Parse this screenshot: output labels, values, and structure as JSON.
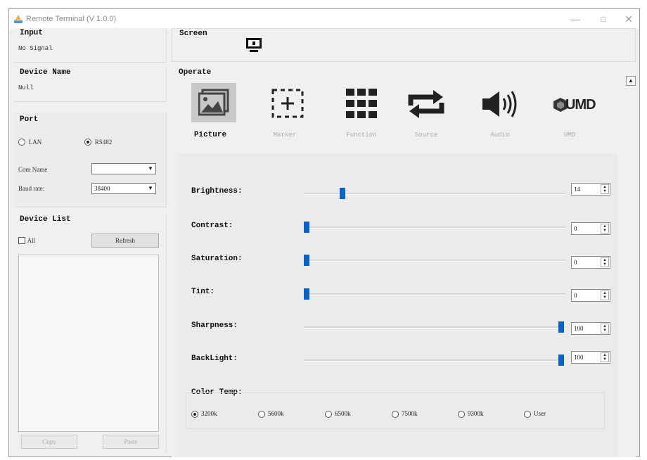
{
  "window": {
    "title": "Remote Terminal (V 1.0.0)",
    "controls": {
      "minimize": "—",
      "maximize": "□",
      "close": "✕"
    }
  },
  "input": {
    "title": "Input",
    "value": "No Signal"
  },
  "device_name": {
    "title": "Device Name",
    "value": "Null"
  },
  "port": {
    "title": "Port",
    "options": [
      {
        "label": "LAN",
        "selected": false
      },
      {
        "label": "RS482",
        "selected": true
      }
    ],
    "com_name_label": "Com Name",
    "com_name_value": "",
    "baud_rate_label": "Baud rate:",
    "baud_rate_value": "38400"
  },
  "device_list": {
    "title": "Device List",
    "all_label": "All",
    "refresh_label": "Refresh",
    "copy_label": "Copy",
    "paste_label": "Paste"
  },
  "screen": {
    "title": "Screen"
  },
  "operate": {
    "title": "Operate",
    "tabs": [
      {
        "label": "Picture",
        "icon": "picture-icon",
        "active": true
      },
      {
        "label": "Marker",
        "icon": "marker-icon",
        "active": false
      },
      {
        "label": "Function",
        "icon": "function-grid-icon",
        "active": false
      },
      {
        "label": "Source",
        "icon": "source-cycle-icon",
        "active": false
      },
      {
        "label": "Audio",
        "icon": "speaker-icon",
        "active": false
      },
      {
        "label": "UMD",
        "icon": "umd-icon",
        "active": false
      }
    ],
    "umd_logo_text": "UMD",
    "sliders": [
      {
        "label": "Brightness:",
        "value": "14",
        "level": 14
      },
      {
        "label": "Contrast:",
        "value": "0",
        "level": 0
      },
      {
        "label": "Saturation:",
        "value": "0",
        "level": 0
      },
      {
        "label": "Tint:",
        "value": "0",
        "level": 0
      },
      {
        "label": "Sharpness:",
        "value": "100",
        "level": 100
      },
      {
        "label": "BackLight:",
        "value": "100",
        "level": 100
      }
    ],
    "color_temp": {
      "title": "Color Temp:",
      "options": [
        {
          "label": "3200k",
          "selected": true
        },
        {
          "label": "5600k",
          "selected": false
        },
        {
          "label": "6500k",
          "selected": false
        },
        {
          "label": "7500k",
          "selected": false
        },
        {
          "label": "9300k",
          "selected": false
        },
        {
          "label": "User",
          "selected": false
        }
      ]
    }
  },
  "colors": {
    "accent": "#0a64c8",
    "background": "#f0f0f0",
    "active_tab_bg": "#c8c8c8"
  }
}
